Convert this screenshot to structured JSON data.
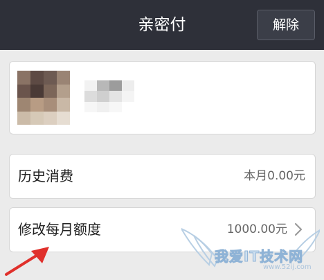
{
  "header": {
    "title": "亲密付",
    "remove_label": "解除"
  },
  "profile": {
    "avatar": "blurred-avatar",
    "nickname": "blurred-nickname"
  },
  "history": {
    "label": "历史消费",
    "value": "本月0.00元"
  },
  "quota": {
    "label": "修改每月额度",
    "value": "1000.00元",
    "icon": "chevron-right-icon"
  },
  "watermark": {
    "text": "我爱IT技术网",
    "url": "www.52ij.com"
  },
  "colors": {
    "titlebar": "#2e3039",
    "background": "#ebebeb",
    "arrow": "#e0302b"
  }
}
